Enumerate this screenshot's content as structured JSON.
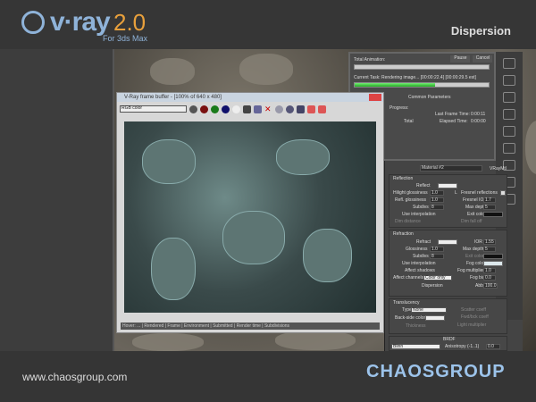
{
  "header": {
    "brand": "v·ray",
    "version": "2.0",
    "subtitle": "For 3ds Max",
    "title": "Dispersion"
  },
  "footer": {
    "url": "www.chaosgroup.com",
    "company": "CHAOSGROUP"
  },
  "progress_dialog": {
    "total_label": "Total Animation:",
    "pause": "Pause",
    "cancel": "Cancel",
    "current_task": "Current Task:  Rendering image... [00:00:22.4] [00:00:29.5 est]",
    "current_progress": 0.6,
    "section": "Common Parameters",
    "progress_label": "Progress:",
    "last_frame_label": "Last Frame Time:",
    "last_frame": "0:00:11",
    "total": "Total",
    "elapsed_label": "Elapsed Time:",
    "elapsed": "0:00:00"
  },
  "frame_buffer": {
    "title": "V-Ray frame buffer - [100% of 640 x 480]",
    "channel": "RGB color",
    "status": "Hover:  ...  | Rendered | Frame | Environment | Submitted | Render time | Subdivisions"
  },
  "material": {
    "name": "Material #2",
    "type": "VRayMtl",
    "reflection": {
      "header": "Reflection",
      "reflect": "Reflect",
      "hilight_gloss": "Hilight glossiness",
      "hilight_val": "1.0",
      "l": "L",
      "fresnel": "Fresnel reflections",
      "refl_gloss": "Refl. glossiness",
      "refl_val": "1.0",
      "fresnel_ior": "Fresnel IOR",
      "fresnel_ior_val": "1.7",
      "subdivs": "Subdivs",
      "subdivs_val": "8",
      "max_depth": "Max depth",
      "max_depth_val": "5",
      "use_interp": "Use interpolation",
      "exit_color": "Exit color",
      "dim_distance": "Dim distance",
      "dim_falloff": "Dim fall off"
    },
    "refraction": {
      "header": "Refraction",
      "refract": "Refract",
      "ior": "IOR",
      "ior_val": "1.55",
      "glossiness": "Glossiness",
      "gloss_val": "1.0",
      "max_depth": "Max depth",
      "max_depth_val": "5",
      "subdivs": "Subdivs",
      "subdivs_val": "8",
      "exit_color": "Exit color",
      "use_interp": "Use interpolation",
      "fog_color": "Fog color",
      "affect_shadows": "Affect shadows",
      "fog_mult": "Fog multiplier",
      "fog_mult_val": "1.0",
      "affect_channels": "Affect channels",
      "channels_val": "Color only",
      "fog_bias": "Fog bias",
      "fog_bias_val": "0.0",
      "dispersion": "Dispersion",
      "abbe": "Abbe",
      "abbe_val": "100.0"
    },
    "translucency": {
      "header": "Translucency",
      "type": "Type",
      "type_val": "None",
      "scatter": "Scatter coeff",
      "fwd": "Fwd/bck coeff",
      "back_side": "Back-side color",
      "light_mult": "Light multiplier",
      "thickness": "Thickness"
    },
    "brdf": {
      "header": "BRDF",
      "type_val": "Blinn",
      "anisotropy": "Anisotropy (-1..1)",
      "anisotropy_val": "0.0"
    }
  }
}
